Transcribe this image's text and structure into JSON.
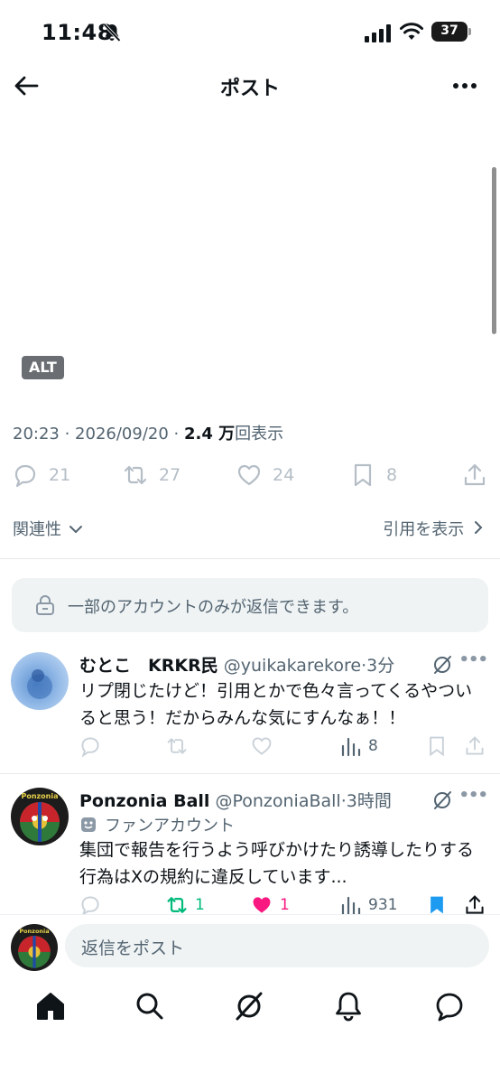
{
  "status": {
    "time": "11:48",
    "battery": "37"
  },
  "nav": {
    "title": "ポスト"
  },
  "media": {
    "alt_label": "ALT"
  },
  "meta": {
    "time": "20:23",
    "date": "2026/09/20",
    "views_number": "2.4 万",
    "views_suffix": "回表示",
    "sep": " · "
  },
  "actions": {
    "replies": "21",
    "reposts": "27",
    "likes": "24",
    "bookmarks": "8"
  },
  "sort": {
    "left_label": "関連性",
    "right_label": "引用を表示"
  },
  "restrict": {
    "text": "一部のアカウントのみが返信できます。"
  },
  "replies": [
    {
      "name": "むとこ　KRKR民",
      "handle": "@yuikakarekore",
      "time": "·3分",
      "text": "リプ閉じたけど！引用とかで色々言ってくるやついると思う！だからみんな気にすんなぁ！！",
      "views": "8"
    },
    {
      "name": "Ponzonia Ball",
      "handle": "@PonzoniaBall",
      "time": "·3時間",
      "badge": "ファンアカウント",
      "text": "集団で報告を行うよう呼びかけたり誘導したりする行為はXの規約に違反しています...",
      "reposts": "1",
      "likes": "1",
      "views": "931",
      "avatar_label": "Ponzonia"
    }
  ],
  "compose": {
    "placeholder": "返信をポスト",
    "avatar_label": "Ponzonia"
  },
  "colors": {
    "accent": "#1d9bf0",
    "repost_green": "#00ba7c",
    "like_pink": "#f91880",
    "muted": "#536471"
  }
}
